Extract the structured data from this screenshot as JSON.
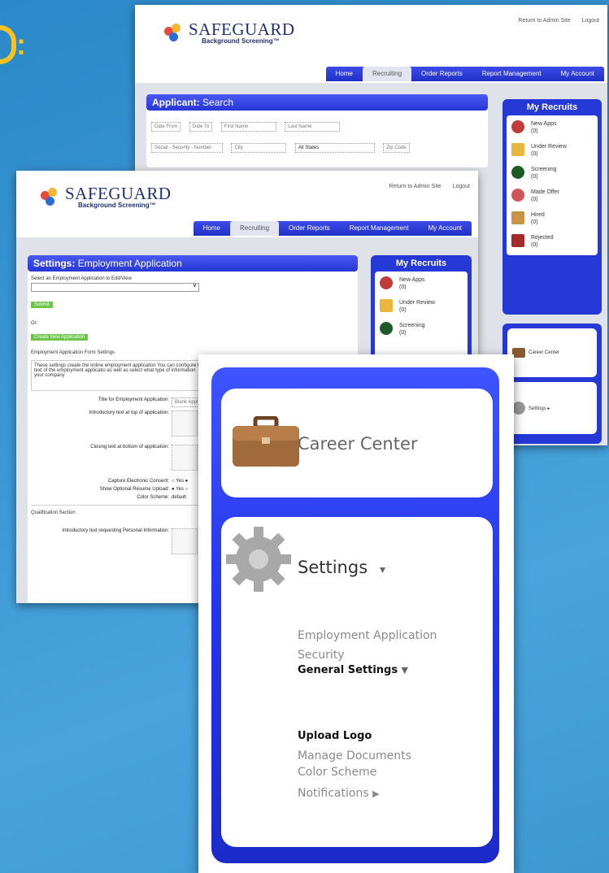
{
  "page": {
    "partial_heading": ":"
  },
  "back_window": {
    "logo": {
      "name": "SAFEGUARD",
      "tagline": "Background Screening™"
    },
    "top_links": [
      "Return to Admin Site",
      "Logout"
    ],
    "nav": [
      {
        "label": "Home"
      },
      {
        "label": "Recruiting"
      },
      {
        "label": "Order Reports"
      },
      {
        "label": "Report Management"
      },
      {
        "label": "My Account"
      }
    ],
    "search": {
      "title_bold": "Applicant:",
      "title_rest": "Search",
      "fields_row1": [
        "Date From",
        "Date To",
        "First Name",
        "Last Name"
      ],
      "fields_row2": [
        "Social - Security - Number",
        "City"
      ],
      "state_select": "All States",
      "zip": "Zip Code"
    },
    "recruits": {
      "title": "My Recruits",
      "items": [
        {
          "label": "New Apps",
          "count": "(0)"
        },
        {
          "label": "Under Review",
          "count": "(0)"
        },
        {
          "label": "Screening",
          "count": "(0)"
        },
        {
          "label": "Made Offer",
          "count": "(0)"
        },
        {
          "label": "Hired",
          "count": "(0)"
        },
        {
          "label": "Rejected",
          "count": "(0)"
        }
      ]
    },
    "side": {
      "career": "Career Center",
      "settings": "Settings ▸"
    }
  },
  "mid_window": {
    "logo": {
      "name": "SAFEGUARD",
      "tagline": "Background Screening™"
    },
    "top_links": [
      "Return to Admin Site",
      "Logout"
    ],
    "nav": [
      {
        "label": "Home"
      },
      {
        "label": "Recruiting"
      },
      {
        "label": "Order Reports"
      },
      {
        "label": "Report Management"
      },
      {
        "label": "My Account"
      }
    ],
    "settings": {
      "title_bold": "Settings:",
      "title_rest": "Employment Application",
      "select_label": "Select an Employment Application to Edit/View",
      "submit": "Submit",
      "or": "Or:",
      "create": "Create New Application",
      "form_settings": "Employment Application Form Settings",
      "intro_text": "These settings create the online employment application You can configure the text of the employment applicatio as well as select what type of information your company",
      "rows": [
        {
          "label": "Title for Employment Application:",
          "value": "Blank Appl"
        },
        {
          "label": "Introductory text at top of application:",
          "value": ""
        },
        {
          "label": "Closing text at bottom of application:",
          "value": ""
        },
        {
          "label": "Capture Electronic Consent:",
          "value": "○ Yes ●"
        },
        {
          "label": "Show Optional Resume Upload:",
          "value": "● Yes ○"
        },
        {
          "label": "Color Scheme:",
          "value": "default"
        }
      ],
      "qualification": "Qualification Section",
      "personal": "Introductory text requesting Personal Information:"
    },
    "recruits": {
      "title": "My Recruits",
      "items": [
        {
          "label": "New Apps",
          "count": "(0)"
        },
        {
          "label": "Under Review",
          "count": "(0)"
        },
        {
          "label": "Screening",
          "count": "(0)"
        }
      ]
    }
  },
  "zoom": {
    "career": "Career Center",
    "settings": "Settings",
    "settings_arrow": "▼",
    "links": [
      {
        "label": "Employment Application"
      },
      {
        "label": "Security"
      }
    ],
    "general": "General Settings",
    "general_arrow": "▼",
    "general_links": [
      {
        "label": "Upload Logo",
        "bold": true
      },
      {
        "label": "Manage Documents"
      },
      {
        "label": "Color Scheme"
      }
    ],
    "notifications": "Notifications",
    "notifications_arrow": "▶"
  },
  "colors": {
    "accent_blue": "#2637d4",
    "yellow": "#f7c21b",
    "green": "#6fc54c"
  }
}
